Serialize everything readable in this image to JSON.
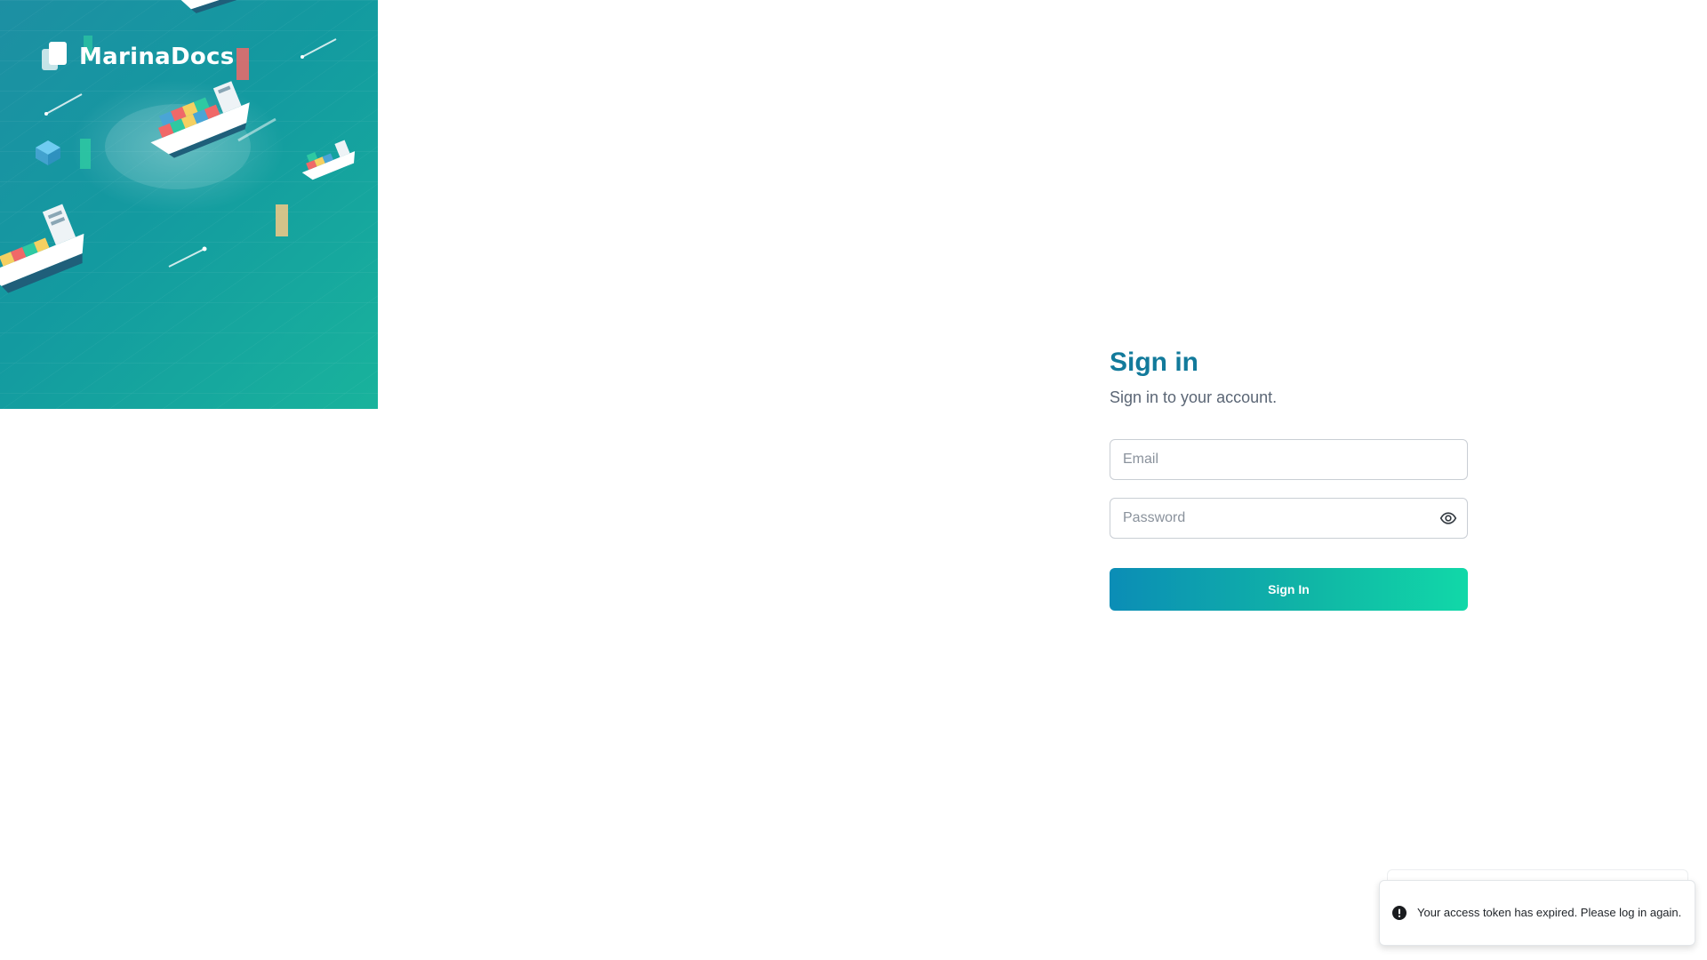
{
  "brand": {
    "name": "MarinaDocs"
  },
  "signin": {
    "title": "Sign in",
    "subtitle": "Sign in to your account.",
    "email_placeholder": "Email",
    "password_placeholder": "Password",
    "submit_label": "Sign In"
  },
  "toast": {
    "message": "Your access token has expired. Please log in again.",
    "icon": "alert-circle-icon"
  },
  "colors": {
    "accent": "#127a9b",
    "button_gradient_start": "#0b8db6",
    "button_gradient_end": "#11d8a8",
    "hero_teal": "#139aa0"
  },
  "icons": {
    "logo": "document-stack-icon",
    "password_toggle": "eye-icon"
  }
}
